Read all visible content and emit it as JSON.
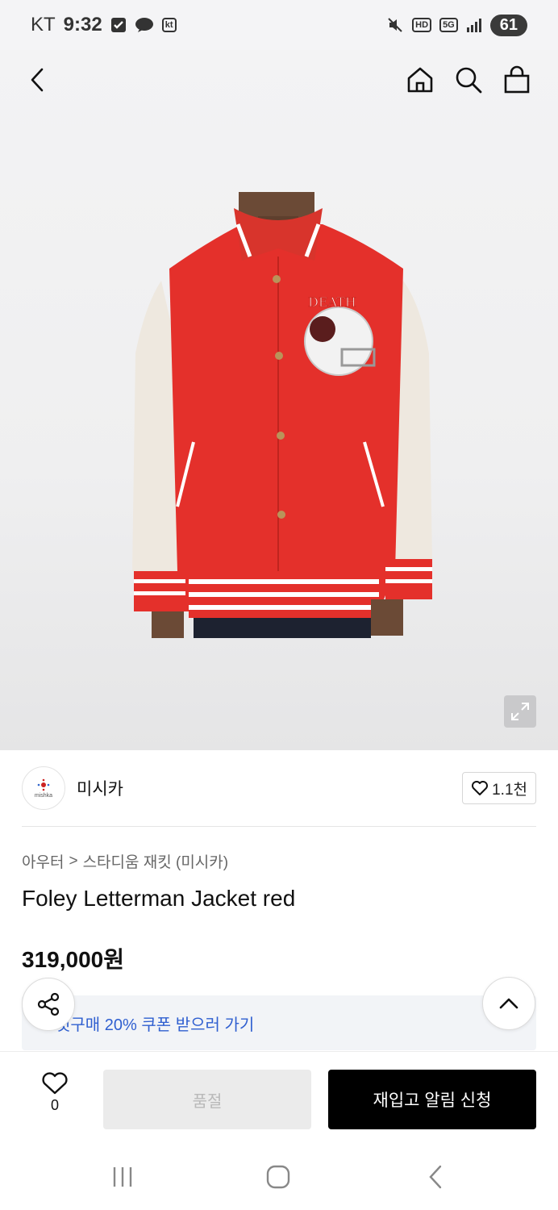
{
  "status_bar": {
    "carrier": "KT",
    "time": "9:32",
    "carrier_badge": "kt",
    "network": "5G",
    "hd": "HD",
    "battery": "61"
  },
  "header": {
    "back_icon": "chevron-left-icon",
    "home_icon": "home-icon",
    "search_icon": "search-icon",
    "bag_icon": "shopping-bag-icon"
  },
  "product": {
    "image_alt_colors": {
      "body": "#e4302b",
      "sleeves": "#eee8df"
    },
    "brand_name": "미시카",
    "brand_logo_text": "mishka",
    "likes": "1.1천",
    "breadcrumb": [
      "아우터",
      "스타디움 재킷 (미시카)"
    ],
    "title": "Foley Letterman Jacket red",
    "price": "319,000원"
  },
  "coupon": {
    "text": "첫구매 20% 쿠폰 받으러 가기",
    "color": "#2f5fd0"
  },
  "action_bar": {
    "wish_count": "0",
    "soldout_label": "품절",
    "restock_label": "재입고 알림 신청"
  }
}
